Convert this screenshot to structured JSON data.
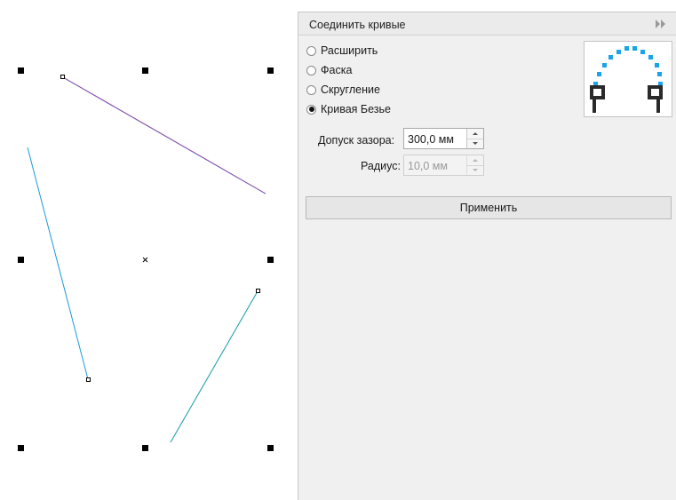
{
  "panel": {
    "title": "Соединить кривые",
    "options": [
      {
        "label": "Расширить",
        "checked": false
      },
      {
        "label": "Фаска",
        "checked": false
      },
      {
        "label": "Скругление",
        "checked": false
      },
      {
        "label": "Кривая Безье",
        "checked": true
      }
    ],
    "gap_tolerance": {
      "label": "Допуск зазора:",
      "value": "300,0 мм"
    },
    "radius": {
      "label": "Радиус:",
      "value": "10,0 мм",
      "disabled": true
    },
    "apply_label": "Применить"
  },
  "canvas": {
    "handle_color": "#000000",
    "curve_color_a": "#9c3a9c",
    "curve_color_b": "#1a9bd8"
  },
  "colors": {
    "preview_dots": "#1aa3e8",
    "preview_nodes": "#2a2a2a"
  },
  "icons": {
    "collapse": "double-chevron-right-icon",
    "preview": "bezier-join-preview-icon"
  }
}
